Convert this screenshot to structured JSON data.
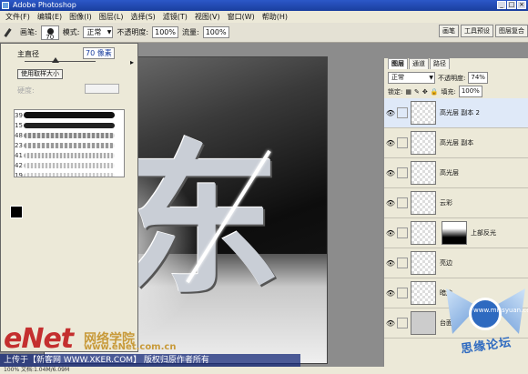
{
  "window": {
    "title": "Adobe Photoshop"
  },
  "menu": [
    "文件(F)",
    "编辑(E)",
    "图像(I)",
    "图层(L)",
    "选择(S)",
    "滤镜(T)",
    "视图(V)",
    "窗口(W)",
    "帮助(H)"
  ],
  "options_bar": {
    "brush_label": "画笔:",
    "brush_size": "70",
    "mode_label": "模式:",
    "mode_value": "正常",
    "opacity_label": "不透明度:",
    "opacity_value": "100%",
    "flow_label": "流量:",
    "flow_value": "100%"
  },
  "palette_tabs": [
    "画笔",
    "工具预设",
    "图层复合"
  ],
  "brush_panel": {
    "diameter_label": "主直径",
    "diameter_value": "70 像素",
    "use_sample_button": "使用取样大小",
    "hardness_label": "硬度:",
    "brush_numbers": [
      "39",
      "15",
      "48",
      "23",
      "41",
      "42",
      "19"
    ]
  },
  "layers_panel": {
    "tabs": [
      "图层",
      "通道",
      "路径"
    ],
    "blend_mode": "正常",
    "opacity_label": "不透明度:",
    "opacity_value": "74%",
    "lock_label": "锁定:",
    "fill_label": "填充:",
    "fill_value": "100%",
    "layers": [
      {
        "name": "高光层 副本 2",
        "active": true
      },
      {
        "name": "高光层 副本",
        "active": false
      },
      {
        "name": "高光层",
        "active": false
      },
      {
        "name": "云彩",
        "active": false
      },
      {
        "name": "上部反光",
        "active": false
      },
      {
        "name": "亮边",
        "active": false
      },
      {
        "name": "暗边",
        "active": false
      },
      {
        "name": "台面",
        "active": false
      }
    ]
  },
  "canvas": {
    "character": "东"
  },
  "watermark": {
    "logo": "eNet",
    "school": "网络学院",
    "website": "www.eNet.com.cn",
    "stamp": "思缘论坛",
    "stamp_url": "www.missyuan.com"
  },
  "caption": "上传于【新客网 WWW.XKER.COM】 版权归原作者所有",
  "status": "100% 文档:1.04M/6.09M"
}
